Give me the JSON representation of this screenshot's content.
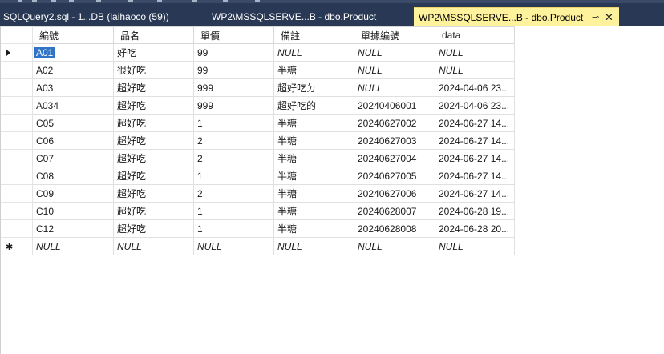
{
  "tabs": [
    {
      "label": "SQLQuery2.sql - 1...DB (laihaoco (59))",
      "active": false
    },
    {
      "label": "WP2\\MSSQLSERVE...B - dbo.Product",
      "active": false
    },
    {
      "label": "WP2\\MSSQLSERVE...B - dbo.Product",
      "active": true,
      "pin_icon": "pin-icon",
      "close_icon": "close-icon"
    }
  ],
  "grid": {
    "columns": [
      "編號",
      "品名",
      "單價",
      "備註",
      "單據編號",
      "data"
    ],
    "rows": [
      [
        "A01",
        "好吃",
        "99",
        "NULL",
        "NULL",
        "NULL"
      ],
      [
        "A02",
        "很好吃",
        "99",
        "半糖",
        "NULL",
        "NULL"
      ],
      [
        "A03",
        "超好吃",
        "999",
        "超好吃ㄉ",
        "NULL",
        "2024-04-06 23..."
      ],
      [
        "A034",
        "超好吃",
        "999",
        "超好吃的",
        "20240406001",
        "2024-04-06 23..."
      ],
      [
        "C05",
        "超好吃",
        "1",
        "半糖",
        "20240627002",
        "2024-06-27 14..."
      ],
      [
        "C06",
        "超好吃",
        "2",
        "半糖",
        "20240627003",
        "2024-06-27 14..."
      ],
      [
        "C07",
        "超好吃",
        "2",
        "半糖",
        "20240627004",
        "2024-06-27 14..."
      ],
      [
        "C08",
        "超好吃",
        "1",
        "半糖",
        "20240627005",
        "2024-06-27 14..."
      ],
      [
        "C09",
        "超好吃",
        "2",
        "半糖",
        "20240627006",
        "2024-06-27 14..."
      ],
      [
        "C10",
        "超好吃",
        "1",
        "半糖",
        "20240628007",
        "2024-06-28 19..."
      ],
      [
        "C12",
        "超好吃",
        "1",
        "半糖",
        "20240628008",
        "2024-06-28 20..."
      ]
    ],
    "new_row": [
      "NULL",
      "NULL",
      "NULL",
      "NULL",
      "NULL",
      "NULL"
    ],
    "current_row_marker": "current-row-arrow-icon",
    "new_row_marker": "new-row-asterisk-icon",
    "selected_cell_value": "A01",
    "null_text": "NULL"
  },
  "colors": {
    "tabbar_bg": "#293955",
    "active_tab_bg": "#fff29d",
    "selection_bg": "#3173c4"
  }
}
